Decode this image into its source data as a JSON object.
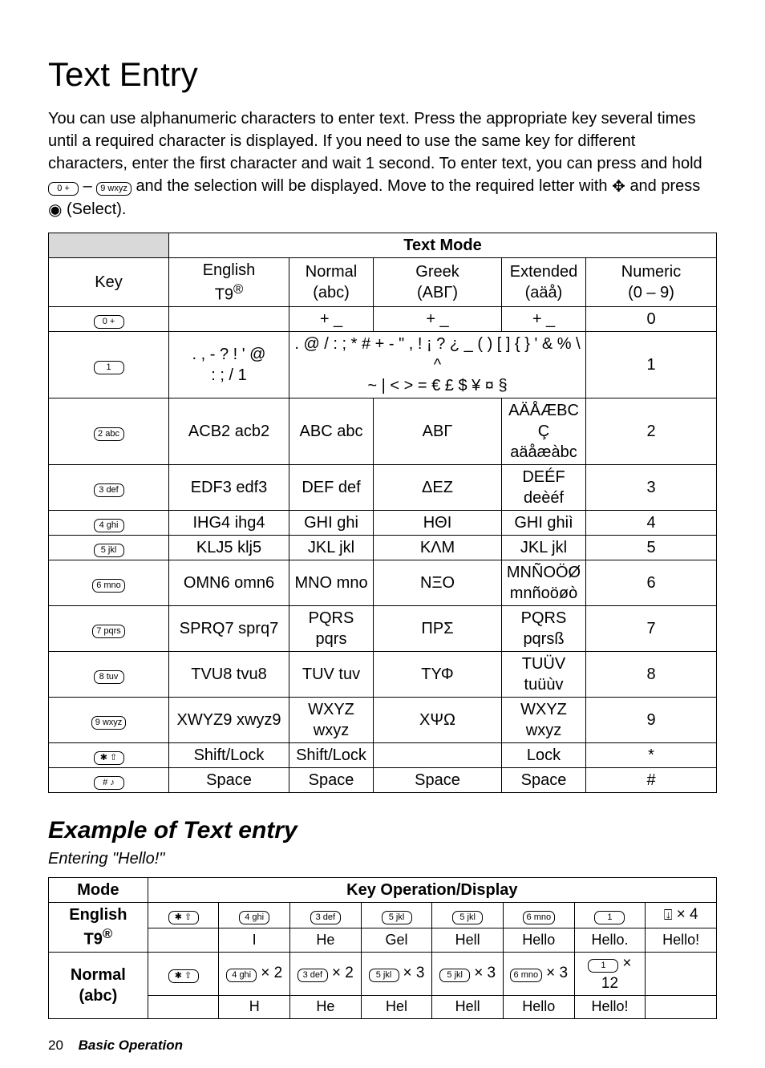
{
  "title": "Text Entry",
  "intro_parts": {
    "a": "You can use alphanumeric characters to enter text. Press the appropriate key several times until a required character is displayed. If you need to use the same key for different characters, enter the first character and wait 1 second. To enter text, you can press and hold ",
    "b": " – ",
    "c": " and the selection will be displayed. Move to the required letter with ",
    "d": " and press ",
    "e": " (Select)."
  },
  "icons": {
    "k0": "0 +",
    "k1": "1",
    "k2": "2 abc",
    "k3": "3 def",
    "k4": "4 ghi",
    "k5": "5 jkl",
    "k6": "6 mno",
    "k7": "7 pqrs",
    "k8": "8 tuv",
    "k9": "9 wxyz",
    "kstar": "✱ ⇧",
    "khash": "# ♪",
    "nav": "✥",
    "select": "◉",
    "down": "⍗"
  },
  "table1": {
    "header_mode": "Text Mode",
    "cols": {
      "key": "Key",
      "english": "English\nT9",
      "normal": "Normal (abc)",
      "greek": "Greek\n(ΑΒΓ)",
      "extended": "Extended\n(aäå)",
      "numeric": "Numeric\n(0 – 9)"
    },
    "rows": [
      {
        "key": "k0",
        "english": "",
        "normal": "+ _",
        "greek": "+ _",
        "extended": "+ _",
        "numeric": "0"
      },
      {
        "key": "k1",
        "english": ". , - ? ! ' @\n: ; / 1",
        "normal_span": ". @ / : ; * # + - \" , ! ¡ ? ¿ _ ( ) [ ] { } ' & % \\ ^\n~ | < > = € £ $ ¥ ¤ §",
        "numeric": "1"
      },
      {
        "key": "k2",
        "english": "ACB2 acb2",
        "normal": "ABC abc",
        "greek": "ΑΒΓ",
        "extended": "AÄÅÆBCÇ\naäåæàbc",
        "numeric": "2"
      },
      {
        "key": "k3",
        "english": "EDF3 edf3",
        "normal": "DEF def",
        "greek": "ΔΕΖ",
        "extended": "DEÉF deèéf",
        "numeric": "3"
      },
      {
        "key": "k4",
        "english": "IHG4 ihg4",
        "normal": "GHI ghi",
        "greek": "ΗΘΙ",
        "extended": "GHI ghiì",
        "numeric": "4"
      },
      {
        "key": "k5",
        "english": "KLJ5 klj5",
        "normal": "JKL jkl",
        "greek": "ΚΛΜ",
        "extended": "JKL jkl",
        "numeric": "5"
      },
      {
        "key": "k6",
        "english": "OMN6 omn6",
        "normal": "MNO mno",
        "greek": "ΝΞΟ",
        "extended": "MNÑOÖØ\nmnñoöøò",
        "numeric": "6"
      },
      {
        "key": "k7",
        "english": "SPRQ7 sprq7",
        "normal": "PQRS pqrs",
        "greek": "ΠΡΣ",
        "extended": "PQRS pqrsß",
        "numeric": "7"
      },
      {
        "key": "k8",
        "english": "TVU8 tvu8",
        "normal": "TUV tuv",
        "greek": "ΤΥΦ",
        "extended": "TUÜV tuüùv",
        "numeric": "8"
      },
      {
        "key": "k9",
        "english": "XWYZ9 xwyz9",
        "normal": "WXYZ wxyz",
        "greek": "ΧΨΩ",
        "extended": "WXYZ wxyz",
        "numeric": "9"
      },
      {
        "key": "kstar",
        "english": "Shift/Lock",
        "normal": "Shift/Lock",
        "greek": "",
        "extended": "Lock",
        "numeric": "*"
      },
      {
        "key": "khash",
        "english": "Space",
        "normal": "Space",
        "greek": "Space",
        "extended": "Space",
        "numeric": "#"
      }
    ]
  },
  "example_heading": "Example of Text entry",
  "example_sub": "Entering \"Hello!\"",
  "table2": {
    "header_mode": "Mode",
    "header_ops": "Key Operation/Display",
    "modes": {
      "english": "English\nT9",
      "normal": "Normal\n(abc)"
    },
    "english_row": {
      "ops": [
        {
          "icon": "kstar",
          "mult": ""
        },
        {
          "icon": "k4",
          "mult": ""
        },
        {
          "icon": "k3",
          "mult": ""
        },
        {
          "icon": "k5",
          "mult": ""
        },
        {
          "icon": "k5",
          "mult": ""
        },
        {
          "icon": "k6",
          "mult": ""
        },
        {
          "icon": "k1",
          "mult": ""
        },
        {
          "icon": "down",
          "mult": "× 4"
        }
      ],
      "disp": [
        "",
        "I",
        "He",
        "Gel",
        "Hell",
        "Hello",
        "Hello.",
        "Hello!"
      ]
    },
    "normal_row": {
      "ops": [
        {
          "icon": "kstar",
          "mult": ""
        },
        {
          "icon": "k4",
          "mult": "× 2"
        },
        {
          "icon": "k3",
          "mult": "× 2"
        },
        {
          "icon": "k5",
          "mult": "× 3"
        },
        {
          "icon": "k5",
          "mult": "× 3"
        },
        {
          "icon": "k6",
          "mult": "× 3"
        },
        {
          "icon": "k1",
          "mult": "× 12"
        },
        {
          "icon": "",
          "mult": ""
        }
      ],
      "disp": [
        "",
        "H",
        "He",
        "Hel",
        "Hell",
        "Hello",
        "Hello!",
        ""
      ]
    }
  },
  "footer": {
    "page": "20",
    "section": "Basic Operation"
  }
}
